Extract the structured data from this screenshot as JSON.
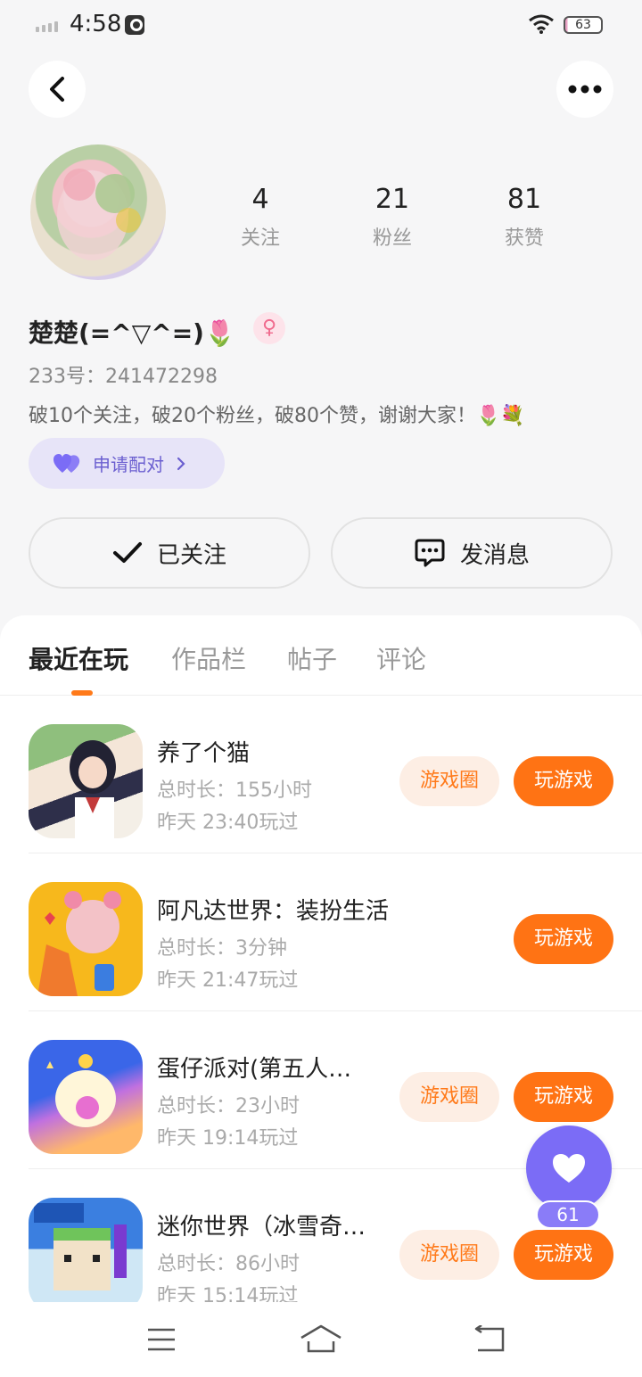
{
  "status_bar": {
    "time": "4:58",
    "battery": "63"
  },
  "profile": {
    "stats": [
      {
        "value": "4",
        "label": "关注"
      },
      {
        "value": "21",
        "label": "粉丝"
      },
      {
        "value": "81",
        "label": "获赞"
      }
    ],
    "nickname": "楚楚(=^▽^=)🌷",
    "gender_symbol": "♀",
    "uid": "233号：241472298",
    "bio": "破10个关注，破20个粉丝，破80个赞，谢谢大家！🌷💐",
    "match_label": "申请配对"
  },
  "actions": {
    "follow_label": "已关注",
    "message_label": "发消息"
  },
  "tabs": [
    "最近在玩",
    "作品栏",
    "帖子",
    "评论"
  ],
  "games": [
    {
      "name": "养了个猫",
      "duration": "总时长：155小时",
      "last_played": "昨天 23:40玩过",
      "circle_label": "游戏圈",
      "play_label": "玩游戏"
    },
    {
      "name": "阿凡达世界：装扮生活",
      "duration": "总时长：3分钟",
      "last_played": "昨天 21:47玩过",
      "circle_label": "",
      "play_label": "玩游戏"
    },
    {
      "name": "蛋仔派对(第五人…",
      "duration": "总时长：23小时",
      "last_played": "昨天 19:14玩过",
      "circle_label": "游戏圈",
      "play_label": "玩游戏"
    },
    {
      "name": "迷你世界（冰雪奇…",
      "duration": "总时长：86小时",
      "last_played": "昨天 15:14玩过",
      "circle_label": "游戏圈",
      "play_label": "玩游戏"
    }
  ],
  "fab": {
    "count": "61"
  },
  "colors": {
    "accent": "#ff7314",
    "purple": "#7b6cf6"
  }
}
